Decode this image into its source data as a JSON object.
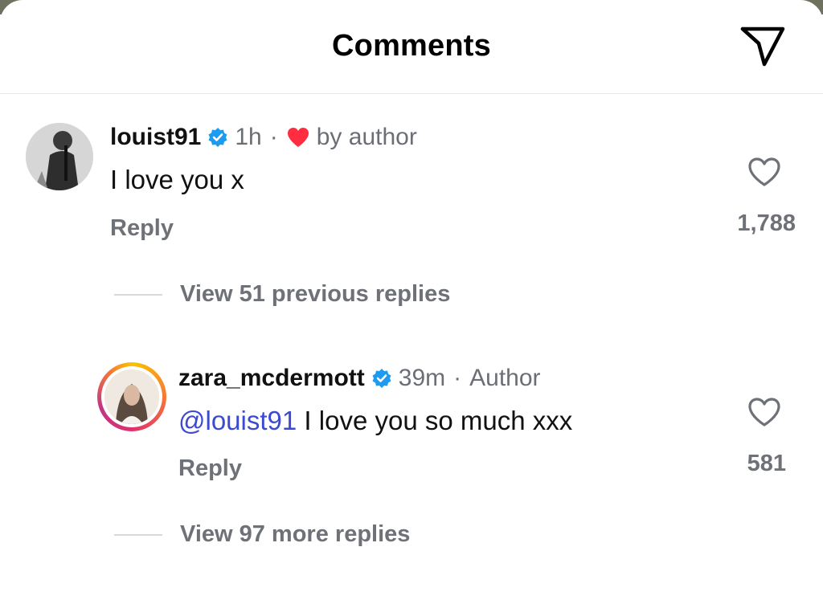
{
  "header": {
    "title": "Comments",
    "send_icon": "paper-plane-icon"
  },
  "comments": [
    {
      "username": "louist91",
      "verified": true,
      "time": "1h",
      "separator": "·",
      "liked_by_author_label": "by author",
      "text": "I love you x",
      "reply_label": "Reply",
      "like_count": "1,788"
    },
    {
      "view_replies_label": "View 51 previous replies"
    },
    {
      "username": "zara_mcdermott",
      "verified": true,
      "time": "39m",
      "separator": "·",
      "author_badge": "Author",
      "mention": "@louist91",
      "text": " I love you so much xxx",
      "reply_label": "Reply",
      "like_count": "581"
    },
    {
      "view_replies_label": "View 97 more replies"
    }
  ],
  "colors": {
    "verified_blue": "#1d9bf0",
    "heart_red": "#ff2d3f",
    "mention_blue": "#3b4ad1",
    "muted_gray": "#6e7177"
  }
}
